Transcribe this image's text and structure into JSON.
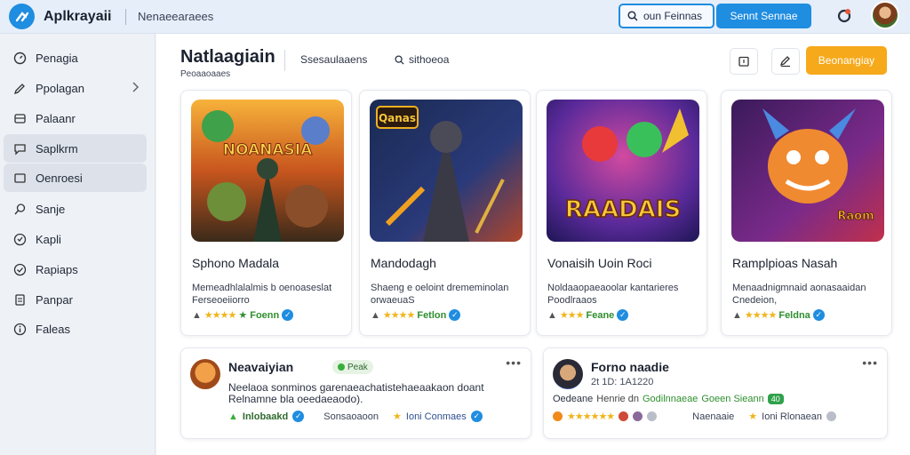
{
  "app": {
    "title": "Aplkrayaii",
    "subtitle": "Nenaeearaees"
  },
  "topbar": {
    "search_label": "oun Feinnas",
    "cta_label": "Sennt Sennae"
  },
  "sidebar": {
    "items": [
      {
        "label": "Penagia",
        "icon": "gauge-icon"
      },
      {
        "label": "Ppolagan",
        "icon": "pencil-icon"
      },
      {
        "label": "Palaanr",
        "icon": "grid-icon"
      },
      {
        "label": "Saplkrm",
        "icon": "chat-icon"
      },
      {
        "label": "Oenroesi",
        "icon": "square-icon"
      },
      {
        "label": "Sanje",
        "icon": "search-icon"
      },
      {
        "label": "Kapli",
        "icon": "shield-icon"
      },
      {
        "label": "Rapiaps",
        "icon": "check-circle-icon"
      },
      {
        "label": "Panpar",
        "icon": "document-icon"
      },
      {
        "label": "Faleas",
        "icon": "info-icon"
      }
    ]
  },
  "main": {
    "title": "Natlaagiain",
    "subtitle": "Peoaaoaaes",
    "tab_label": "Ssesaulaaens",
    "search_label": "sithoeoa",
    "primary_label": "Beonangiay"
  },
  "games": [
    {
      "title": "Sphono Madala",
      "desc_line1": "Memeadhlalalmis b oenoaseslat",
      "desc_line2": "Ferseoeiiorro",
      "rating_label": "Foenn",
      "thumb_text": "NOANASIA"
    },
    {
      "title": "Mandodagh",
      "desc_line1": "Shaeng e oeloint drememinolan",
      "desc_line2": "orwaeuaS",
      "rating_label": "Fetlon",
      "thumb_text": "Qanas"
    },
    {
      "title": "Vonaisih Uoin Roci",
      "desc_line1": "Noldaaopaeaoolar kantarieres",
      "desc_line2": "Poodlraaos",
      "rating_label": "Feane",
      "thumb_text": "RAADAIS"
    },
    {
      "title": "Ramplpioas Nasah",
      "desc_line1": "Menaadnigmnaid aonasaaidan",
      "desc_line2": "Cnedeion,",
      "rating_label": "Feldna",
      "thumb_text": "Raom"
    }
  ],
  "feed": [
    {
      "name": "Neavaiyian",
      "badge": "Peak",
      "text_line1": "Neelaoa sonminos garenaeachatistehaeaakaon doant",
      "text_line2": "Relnamne bla oeedaeaodo).",
      "meta1": "Inlobaakd",
      "meta2": "Sonsaoaoon",
      "meta3": "Ioni Conmaes"
    },
    {
      "name": "Forno naadie",
      "time": "2t 1D: 1A1220",
      "line2_a": "Oedeane",
      "line2_b": "Henrie dn",
      "line2_c": "Godilnnaeae",
      "line2_d": "Goeen Sieann",
      "line2_e": "40",
      "meta2": "Naenaaie",
      "meta3": "Ioni Rlonaean"
    }
  ],
  "colors": {
    "accent": "#1f8de0",
    "primary": "#f6a91a",
    "star": "#f0b51b",
    "verified": "#1f8de0"
  }
}
